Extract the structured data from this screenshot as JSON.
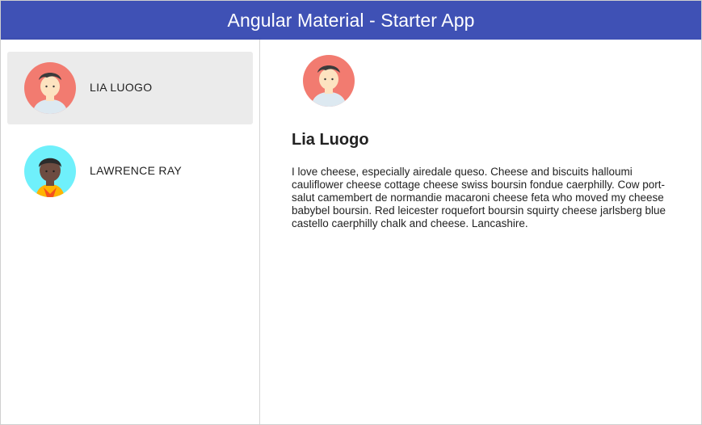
{
  "toolbar": {
    "title": "Angular Material - Starter App",
    "color": "#3f51b5"
  },
  "sidenav": {
    "users": [
      {
        "name": "LIA LUOGO",
        "avatar_icon": "girl-avatar-icon",
        "selected": true
      },
      {
        "name": "LAWRENCE RAY",
        "avatar_icon": "boy-avatar-icon",
        "selected": false
      }
    ],
    "selected_bg": "#ebebeb"
  },
  "detail": {
    "name": "Lia Luogo",
    "avatar_icon": "girl-avatar-icon",
    "bio": "I love cheese, especially airedale queso. Cheese and biscuits halloumi cauliflower cheese cottage cheese swiss boursin fondue caerphilly. Cow port-salut camembert de normandie macaroni cheese feta who moved my cheese babybel boursin. Red leicester roquefort boursin squirty cheese jarlsberg blue castello caerphilly chalk and cheese. Lancashire."
  }
}
